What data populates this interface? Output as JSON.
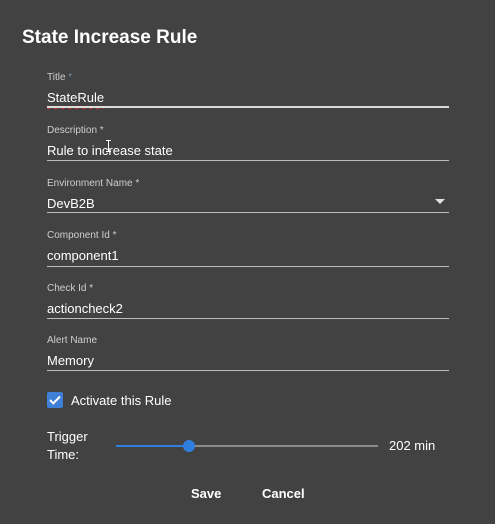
{
  "dialog": {
    "title": "State Increase Rule"
  },
  "fields": {
    "title": {
      "label": "Title",
      "required_mark": " *",
      "value": "StateRule"
    },
    "description": {
      "label": "Description",
      "required_mark": " *",
      "value": "Rule to increase state"
    },
    "environment": {
      "label": "Environment Name",
      "required_mark": " *",
      "value": "DevB2B",
      "icon": "chevron-down-icon"
    },
    "component": {
      "label": "Component Id",
      "required_mark": " *",
      "value": "component1"
    },
    "check": {
      "label": "Check Id",
      "required_mark": " *",
      "value": "actioncheck2"
    },
    "alert": {
      "label": "Alert Name",
      "value": "Memory"
    }
  },
  "activate": {
    "label": "Activate this Rule",
    "checked": true,
    "icon": "checkmark-icon"
  },
  "trigger": {
    "label_line1": "Trigger",
    "label_line2": "Time:",
    "value_text": "202 min",
    "fraction": 0.28
  },
  "actions": {
    "save_label": "Save",
    "cancel_label": "Cancel"
  },
  "colors": {
    "background": "#424242",
    "accent": "#2f7fe0",
    "checkbox": "#3f7fd6",
    "spellcheck": "#d32f2f"
  }
}
